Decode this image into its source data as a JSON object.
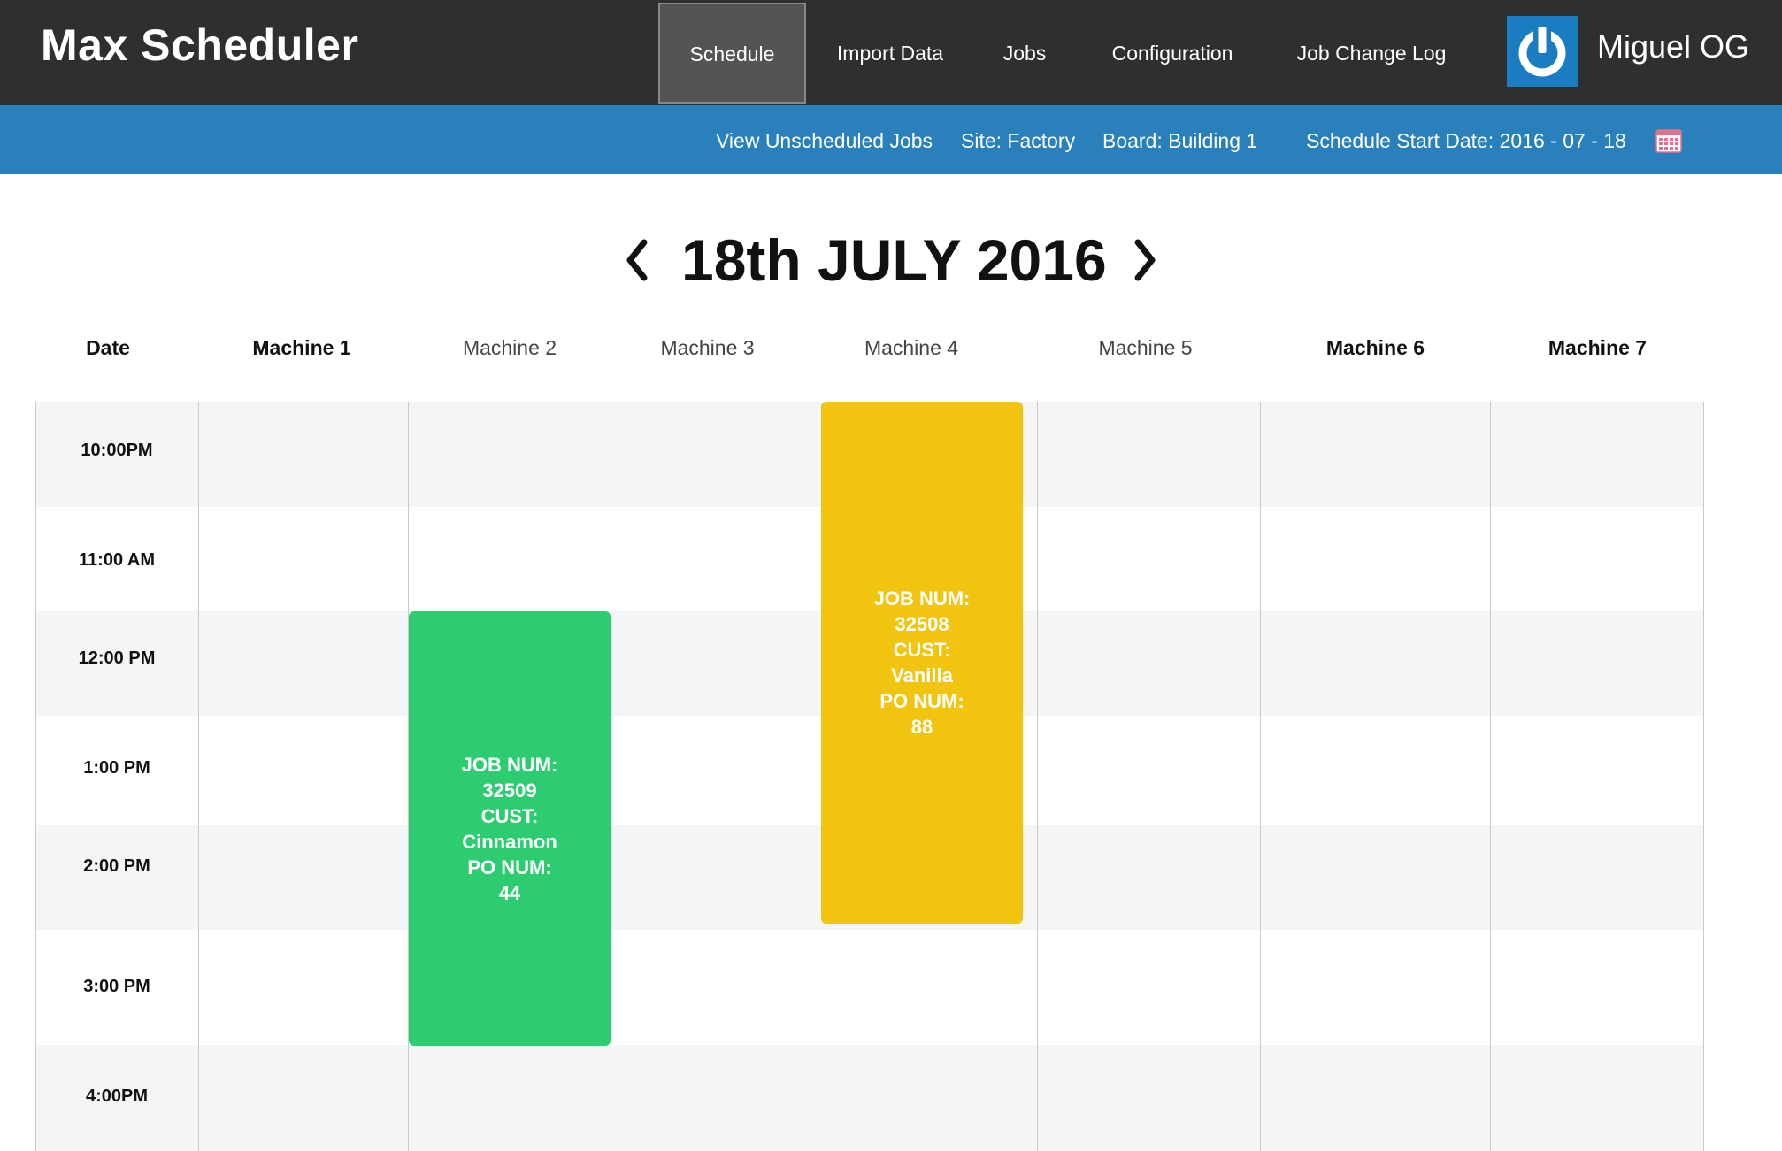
{
  "app": {
    "title": "Max Scheduler"
  },
  "nav": {
    "items": [
      {
        "label": "Schedule",
        "active": true
      },
      {
        "label": "Import Data"
      },
      {
        "label": "Jobs"
      },
      {
        "label": "Configuration"
      },
      {
        "label": "Job Change Log"
      }
    ],
    "user_name": "Miguel OG",
    "user_icon": "power-icon"
  },
  "subnav": {
    "unscheduled": "View Unscheduled Jobs",
    "site": "Site: Factory",
    "board": "Board: Building 1",
    "start_date": "Schedule Start Date: 2016 - 07 - 18",
    "calendar_icon": "calendar-icon"
  },
  "day": {
    "title": "18th  JULY 2016",
    "prev_icon": "chevron-left-icon",
    "next_icon": "chevron-right-icon"
  },
  "columns": [
    "Date",
    "Machine 1",
    "Machine 2",
    "Machine 3",
    "Machine 4",
    "Machine 5",
    "Machine 6",
    "Machine 7"
  ],
  "times": [
    "10:00PM",
    "11:00 AM",
    "12:00 PM",
    "1:00 PM",
    "2:00 PM",
    "3:00 PM",
    "4:00PM"
  ],
  "jobs": [
    {
      "machine": "Machine 4",
      "color": "#f1c40f",
      "lines": [
        "JOB  NUM:",
        "32508",
        "CUST:",
        "Vanilla",
        "PO NUM:",
        "88"
      ]
    },
    {
      "machine": "Machine 2",
      "color": "#2ecc71",
      "lines": [
        "JOB NUM:",
        "32509",
        "CUST:",
        "Cinnamon",
        "PO NUM:",
        "44"
      ]
    }
  ],
  "colors": {
    "topbar": "#2f2f2f",
    "subbar": "#2a80bb",
    "job_green": "#2ecc71",
    "job_yellow": "#f1c40f"
  }
}
